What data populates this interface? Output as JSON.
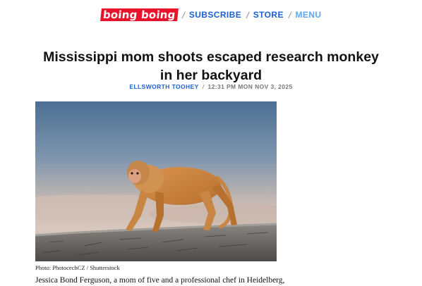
{
  "nav": {
    "logo": "boing boing",
    "subscribe": "SUBSCRIBE",
    "store": "STORE",
    "menu": "MENU",
    "separator": "/"
  },
  "article": {
    "title": "Mississippi mom shoots escaped research monkey in her backyard",
    "author": "ELLSWORTH TOOHEY",
    "byline_separator": "/",
    "timestamp": "12:31 PM MON NOV 3, 2025",
    "photo_caption": "Photo: PhotocechCZ / Shutterstock",
    "body_first_line": "Jessica Bond Ferguson, a mom of five and a professional chef in Heidelberg,"
  },
  "colors": {
    "logo_bg": "#e8132a",
    "link_blue": "#1c5fd3",
    "menu_blue": "#5fa6ee"
  }
}
